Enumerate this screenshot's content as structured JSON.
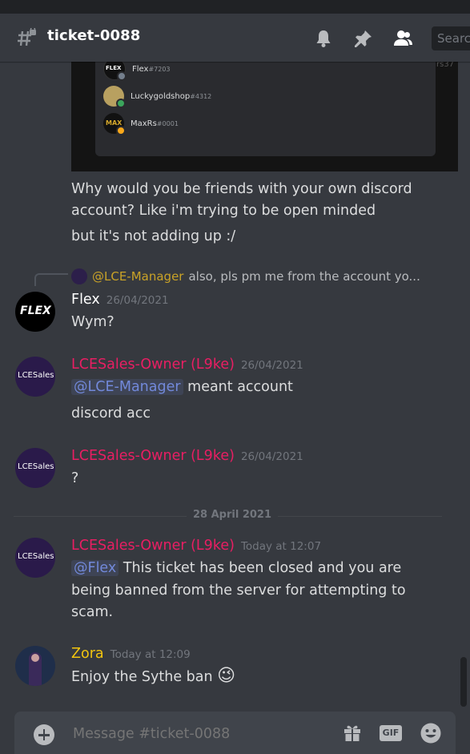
{
  "header": {
    "channel_name": "ticket-0088",
    "search_placeholder": "Searc"
  },
  "embed": {
    "friends": [
      {
        "name": "Flex",
        "tag": "#7203",
        "avatar_text": "FLEX",
        "status_color": "#747f8d"
      },
      {
        "name": "Luckygoldshop",
        "tag": "#4312",
        "avatar_text": "",
        "status_color": "#3ba55c"
      },
      {
        "name": "MaxRs",
        "tag": "#0001",
        "avatar_text": "MAX",
        "status_color": "#faa81a"
      }
    ],
    "corner_text": "rs37"
  },
  "messages": {
    "lines": [
      "Why would you be friends with your own discord",
      "account? Like i'm trying to be open minded",
      "but it's not adding up :/"
    ],
    "reply": {
      "mention": "@LCE-Manager",
      "text": "also, pls pm me from the account yo..."
    },
    "flex": {
      "username": "Flex",
      "timestamp": "26/04/2021",
      "text": "Wym?",
      "avatar_text": "FLEX"
    },
    "lce1": {
      "username": "LCESales-Owner (L9ke)",
      "timestamp": "26/04/2021",
      "mention": "@LCE-Manager",
      "text": "meant account",
      "text2": "discord acc",
      "avatar_text": "LCESales"
    },
    "lce2": {
      "username": "LCESales-Owner (L9ke)",
      "timestamp": "26/04/2021",
      "text": "?",
      "avatar_text": "LCESales"
    },
    "divider": "28 April 2021",
    "lce3": {
      "username": "LCESales-Owner (L9ke)",
      "timestamp": "Today at 12:07",
      "mention": "@Flex",
      "text": "This ticket has been closed and you are",
      "text2": "being banned from the server for attempting to",
      "text3": "scam.",
      "avatar_text": "LCESales"
    },
    "zora": {
      "username": "Zora",
      "timestamp": "Today at 12:09",
      "text": "Enjoy the Sythe ban",
      "emoji": "😉"
    }
  },
  "input": {
    "placeholder": "Message #ticket-0088",
    "gif_label": "GIF"
  },
  "colors": {
    "lce_name": "#e91e63",
    "zora_name": "#f1c40f",
    "reply_mention": "#c9a227",
    "mention": "#7289da"
  }
}
